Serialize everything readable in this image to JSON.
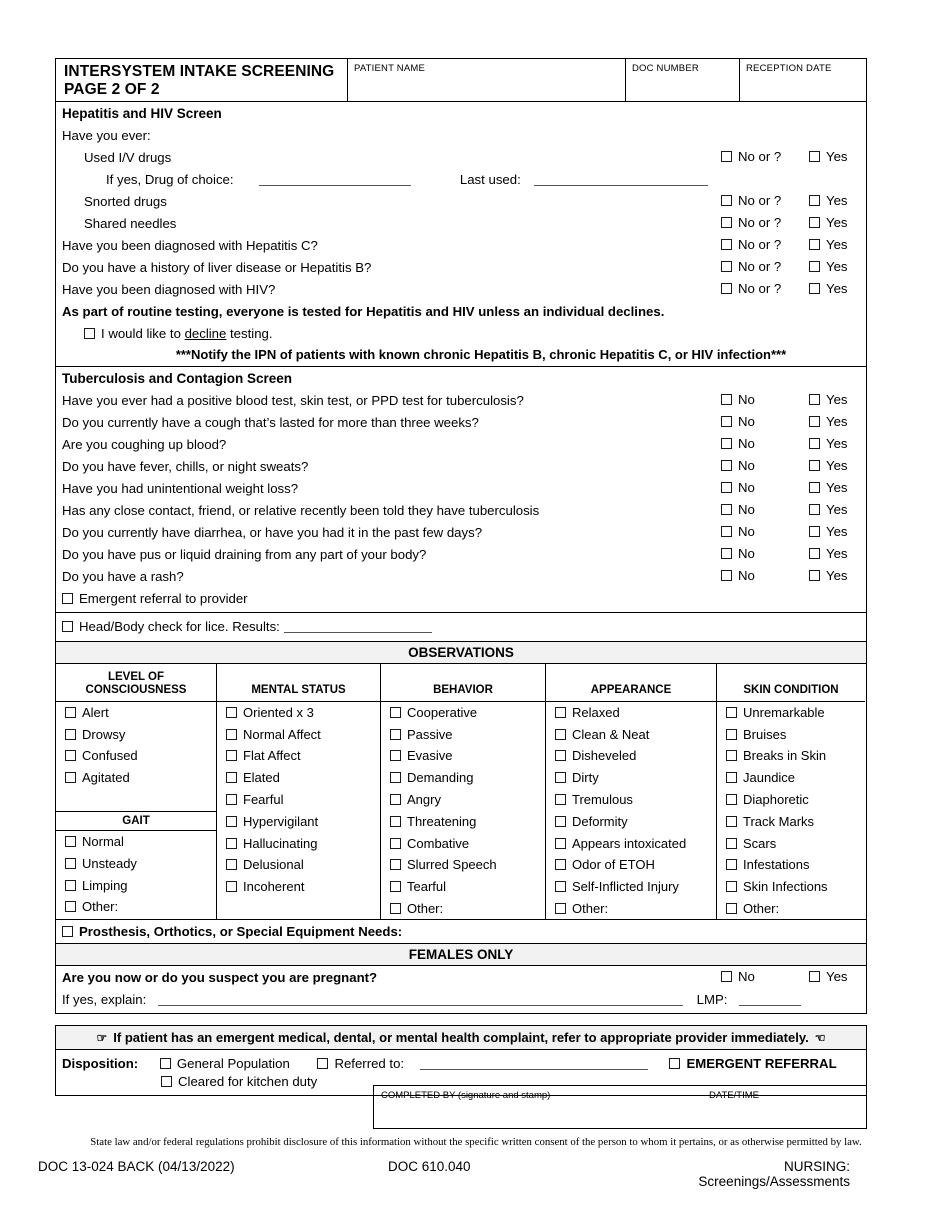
{
  "header": {
    "title_line1": "INTERSYSTEM INTAKE SCREENING",
    "title_line2": "PAGE 2 OF 2",
    "patient_name_label": "PATIENT NAME",
    "doc_number_label": "DOC NUMBER",
    "reception_date_label": "RECEPTION DATE",
    "patient_name_value": "",
    "doc_number_value": "",
    "reception_date_value": ""
  },
  "hepatitis": {
    "section_title": "Hepatitis and HIV Screen",
    "lead_in": "Have you ever:",
    "no_label": "No or ?",
    "yes_label": "Yes",
    "items": [
      {
        "text": "Used I/V drugs",
        "indent": 1
      },
      {
        "text": "Snorted drugs",
        "indent": 1
      },
      {
        "text": "Shared needles",
        "indent": 1
      },
      {
        "text": "Have you been diagnosed with Hepatitis C?",
        "indent": 0
      },
      {
        "text": "Do you have a history of liver disease or Hepatitis B?",
        "indent": 0
      },
      {
        "text": "Have you been diagnosed with HIV?",
        "indent": 0
      }
    ],
    "drug_of_choice_label": "If yes, Drug of choice:",
    "drug_of_choice_value": "",
    "last_used_label": "Last used:",
    "last_used_value": "",
    "routine_testing_note": "As part of routine testing, everyone is tested for Hepatitis and HIV unless an individual declines.",
    "decline_pre": "I would like to ",
    "decline_word": "decline",
    "decline_post": " testing.",
    "ipn_notice": "***Notify the IPN of patients with known chronic Hepatitis B, chronic Hepatitis C, or HIV infection***"
  },
  "tuberculosis": {
    "section_title": "Tuberculosis and Contagion Screen",
    "no_label": "No",
    "yes_label": "Yes",
    "questions": [
      "Have you ever had a positive blood test, skin test, or PPD test for tuberculosis?",
      "Do you currently have a cough that’s lasted for more than three weeks?",
      "Are you coughing up blood?",
      "Do you have fever, chills, or night sweats?",
      "Have you had unintentional weight loss?",
      "Has any close contact, friend, or relative recently been told they have tuberculosis",
      "Do you currently have diarrhea, or have you had it in the past few days?",
      "Do you have pus or liquid draining from any part of your body?",
      "Do you have a rash?"
    ],
    "emergent_referral": "Emergent referral to provider"
  },
  "lice": {
    "text": "Head/Body check for lice.  Results:",
    "value": ""
  },
  "observations": {
    "band_title": "OBSERVATIONS",
    "columns": [
      {
        "header_line1": "LEVEL OF",
        "header_line2": "CONSCIOUSNESS",
        "items": [
          "Alert",
          "Drowsy",
          "Confused",
          "Agitated"
        ],
        "sub_header": "GAIT",
        "sub_items": [
          "Normal",
          "Unsteady",
          "Limping",
          "Other:"
        ]
      },
      {
        "header_line1": "MENTAL STATUS",
        "header_line2": "",
        "items": [
          "Oriented x 3",
          "Normal Affect",
          "Flat Affect",
          "Elated",
          "Fearful",
          "Hypervigilant",
          "Hallucinating",
          "Delusional",
          "Incoherent"
        ]
      },
      {
        "header_line1": "BEHAVIOR",
        "header_line2": "",
        "items": [
          "Cooperative",
          "Passive",
          "Evasive",
          "Demanding",
          "Angry",
          "Threatening",
          "Combative",
          "Slurred Speech",
          "Tearful",
          "Other:"
        ]
      },
      {
        "header_line1": "APPEARANCE",
        "header_line2": "",
        "items": [
          "Relaxed",
          "Clean & Neat",
          "Disheveled",
          "Dirty",
          "Tremulous",
          "Deformity",
          "Appears intoxicated",
          "Odor of ETOH",
          "Self-Inflicted Injury",
          "Other:"
        ]
      },
      {
        "header_line1": "SKIN CONDITION",
        "header_line2": "",
        "items": [
          "Unremarkable",
          "Bruises",
          "Breaks in Skin",
          "Jaundice",
          "Diaphoretic",
          "Track Marks",
          "Scars",
          "Infestations",
          "Skin Infections",
          "Other:"
        ]
      }
    ]
  },
  "prosthesis": {
    "text": "Prosthesis, Orthotics, or Special Equipment Needs:"
  },
  "females": {
    "band_title": "FEMALES ONLY",
    "question": "Are you now or do you suspect you are pregnant?",
    "no_label": "No",
    "yes_label": "Yes",
    "explain_label": "If yes, explain:",
    "explain_value": "",
    "lmp_label": "LMP:",
    "lmp_value": ""
  },
  "disposition": {
    "warning": "If patient has an emergent medical, dental, or mental health complaint, refer to appropriate provider immediately.",
    "warning_glyph_left": "☞",
    "warning_glyph_right": "☜",
    "label": "Disposition:",
    "general_population": "General Population",
    "referred_to": "Referred to:",
    "referred_to_value": "",
    "emergent_referral": "EMERGENT REFERRAL",
    "cleared_kitchen": "Cleared for kitchen duty"
  },
  "completed_by": {
    "label": "COMPLETED BY (signature and stamp)",
    "datetime_label": "DATE/TIME",
    "value": "",
    "datetime_value": ""
  },
  "footer": {
    "disclaimer": "State law and/or federal regulations prohibit disclosure of this information without the specific written consent of the person to whom it pertains, or as otherwise permitted by law.",
    "form_number": "DOC 13-024 BACK (04/13/2022)",
    "policy_number": "DOC 610.040",
    "category": "NURSING: Screenings/Assessments"
  }
}
